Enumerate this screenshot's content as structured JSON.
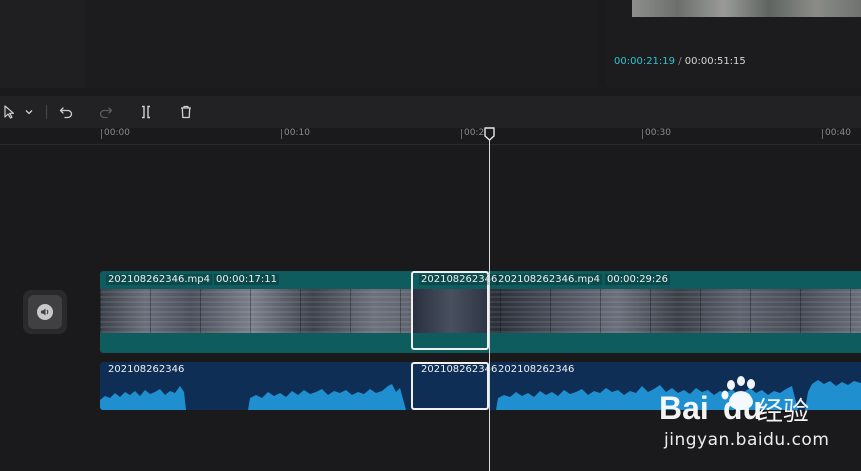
{
  "preview": {
    "current_time": "00:00:21:19",
    "separator": "/",
    "total_time": "00:00:51:15"
  },
  "toolbar": {
    "icons": [
      "select-cursor-icon",
      "chevron-down-icon",
      "undo-icon",
      "redo-icon",
      "split-icon",
      "delete-icon"
    ]
  },
  "ruler": {
    "ticks": [
      "00:00",
      "00:10",
      "00:2",
      "00:30",
      "00:40"
    ]
  },
  "timeline": {
    "video_clips": [
      {
        "name": "202108262346.mp4",
        "duration": "00:00:17:11"
      },
      {
        "name": "202108262346",
        "duration": ""
      },
      {
        "name": "202108262346.mp4",
        "duration": "00:00:29:26"
      }
    ],
    "audio_clips": [
      {
        "name": "202108262346"
      },
      {
        "name": "202108262346"
      },
      {
        "name": "202108262346"
      }
    ]
  },
  "watermark": {
    "brand_text": "Bai",
    "brand_text_2": "du",
    "jingyan_label": "经验",
    "url": "jingyan.baidu.com"
  },
  "colors": {
    "accent_timecode": "#2fc3d0",
    "video_track": "#0e5c5e",
    "audio_track": "#0e2e55",
    "waveform": "#1f8fd0"
  }
}
